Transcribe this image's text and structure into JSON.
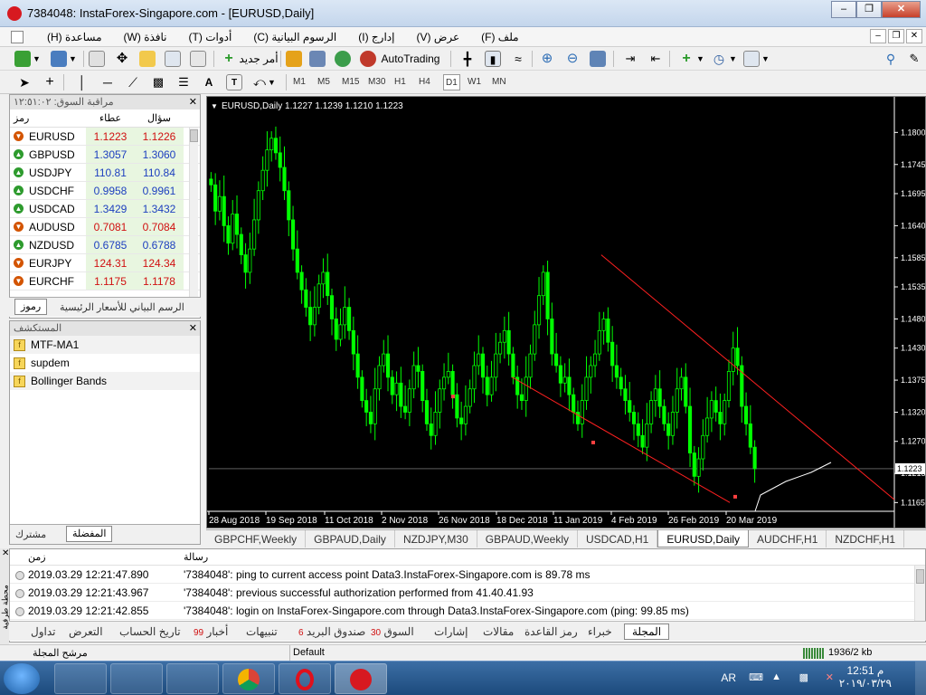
{
  "window": {
    "title": "7384048: InstaForex-Singapore.com - [EURUSD,Daily]"
  },
  "menu": [
    "ملف (F)",
    "عرض (V)",
    "إدارج (I)",
    "الرسوم البيانية (C)",
    "أدوات (T)",
    "نافذة (W)",
    "مساعدة (H)"
  ],
  "toolbar": {
    "new_order": "أمر جديد",
    "autotrading": "AutoTrading"
  },
  "timeframes": [
    "M1",
    "M5",
    "M15",
    "M30",
    "H1",
    "H4",
    "D1",
    "W1",
    "MN"
  ],
  "selected_timeframe": "D1",
  "market_watch": {
    "title": "مراقبة السوق: ١٢:٥١:٠٢",
    "columns": {
      "symbol": "رمز",
      "bid": "عطاء",
      "ask": "سؤال"
    },
    "rows": [
      {
        "symbol": "EURUSD",
        "bid": "1.1223",
        "ask": "1.1226",
        "dir": "down"
      },
      {
        "symbol": "GBPUSD",
        "bid": "1.3057",
        "ask": "1.3060",
        "dir": "up"
      },
      {
        "symbol": "USDJPY",
        "bid": "110.81",
        "ask": "110.84",
        "dir": "up"
      },
      {
        "symbol": "USDCHF",
        "bid": "0.9958",
        "ask": "0.9961",
        "dir": "up"
      },
      {
        "symbol": "USDCAD",
        "bid": "1.3429",
        "ask": "1.3432",
        "dir": "up"
      },
      {
        "symbol": "AUDUSD",
        "bid": "0.7081",
        "ask": "0.7084",
        "dir": "down"
      },
      {
        "symbol": "NZDUSD",
        "bid": "0.6785",
        "ask": "0.6788",
        "dir": "up"
      },
      {
        "symbol": "EURJPY",
        "bid": "124.31",
        "ask": "124.34",
        "dir": "down"
      },
      {
        "symbol": "EURCHF",
        "bid": "1.1175",
        "ask": "1.1178",
        "dir": "down"
      }
    ],
    "tabs": [
      "رموز",
      "الرسم البياني للأسعار الرئيسية"
    ]
  },
  "navigator": {
    "title": "المستكشف",
    "items": [
      "MTF-MA1",
      "supdem",
      "Bollinger Bands"
    ],
    "tabs": [
      "مشترك",
      "المفضلة"
    ]
  },
  "chart_data": {
    "type": "candlestick",
    "header": "EURUSD,Daily  1.1227 1.1239 1.1210 1.1223",
    "yticks": [
      "1.1800",
      "1.1745",
      "1.1695",
      "1.1640",
      "1.1585",
      "1.1535",
      "1.1480",
      "1.1430",
      "1.1375",
      "1.1320",
      "1.1270",
      "1.1215",
      "1.1165"
    ],
    "current_price": "1.1223",
    "xticks": [
      "28 Aug 2018",
      "19 Sep 2018",
      "11 Oct 2018",
      "2 Nov 2018",
      "26 Nov 2018",
      "18 Dec 2018",
      "11 Jan 2019",
      "4 Feb 2019",
      "26 Feb 2019",
      "20 Mar 2019"
    ],
    "ylim": [
      1.115,
      1.183
    ],
    "up_color": "#00ff00",
    "down_color": "#00ff00",
    "closes": [
      1.171,
      1.1665,
      1.169,
      1.164,
      1.161,
      1.166,
      1.1625,
      1.159,
      1.156,
      1.16,
      1.165,
      1.17,
      1.1735,
      1.177,
      1.179,
      1.1765,
      1.174,
      1.17,
      1.165,
      1.16,
      1.156,
      1.153,
      1.15,
      1.147,
      1.15,
      1.154,
      1.156,
      1.152,
      1.148,
      1.1445,
      1.147,
      1.15,
      1.146,
      1.142,
      1.138,
      1.134,
      1.132,
      1.13,
      1.136,
      1.14,
      1.142,
      1.138,
      1.135,
      1.137,
      1.133,
      1.132,
      1.136,
      1.14,
      1.139,
      1.134,
      1.13,
      1.128,
      1.132,
      1.136,
      1.138,
      1.139,
      1.135,
      1.131,
      1.13,
      1.133,
      1.136,
      1.14,
      1.142,
      1.138,
      1.135,
      1.138,
      1.142,
      1.144,
      1.146,
      1.142,
      1.138,
      1.135,
      1.134,
      1.138,
      1.142,
      1.147,
      1.152,
      1.156,
      1.148,
      1.142,
      1.14,
      1.137,
      1.138,
      1.135,
      1.132,
      1.13,
      1.134,
      1.138,
      1.14,
      1.142,
      1.146,
      1.148,
      1.144,
      1.14,
      1.138,
      1.136,
      1.134,
      1.132,
      1.13,
      1.128,
      1.126,
      1.13,
      1.134,
      1.136,
      1.133,
      1.13,
      1.128,
      1.132,
      1.136,
      1.138,
      1.133,
      1.125,
      1.121,
      1.124,
      1.128,
      1.131,
      1.134,
      1.132,
      1.13,
      1.134,
      1.139,
      1.143,
      1.14,
      1.133,
      1.13,
      1.126,
      1.1223
    ],
    "trendlines": [
      {
        "from": [
          0.48,
          1.159
        ],
        "to": [
          1.0,
          1.117
        ],
        "color": "#ff2020"
      },
      {
        "from": [
          0.35,
          1.138
        ],
        "to": [
          0.76,
          1.1165
        ],
        "color": "#ff2020"
      }
    ]
  },
  "chart_tabs": [
    "GBPCHF,Weekly",
    "GBPAUD,Daily",
    "NZDJPY,M30",
    "GBPAUD,Weekly",
    "USDCAD,H1",
    "EURUSD,Daily",
    "AUDCHF,H1",
    "NZDCHF,H1"
  ],
  "active_chart_tab": "EURUSD,Daily",
  "terminal": {
    "columns": {
      "time": "زمن",
      "message": "رسالة"
    },
    "rows": [
      {
        "time": "2019.03.29 12:21:47.890",
        "message": "'7384048': ping to current access point Data3.InstaForex-Singapore.com is 89.78 ms"
      },
      {
        "time": "2019.03.29 12:21:43.967",
        "message": "'7384048': previous successful authorization performed from 41.40.41.93"
      },
      {
        "time": "2019.03.29 12:21:42.855",
        "message": "'7384048': login on InstaForex-Singapore.com through Data3.InstaForex-Singapore.com (ping: 99.85 ms)"
      }
    ],
    "side_label": "محطة طرفية",
    "tabs": [
      {
        "label": "تداول",
        "badge": ""
      },
      {
        "label": "التعرض",
        "badge": ""
      },
      {
        "label": "تاريخ الحساب",
        "badge": ""
      },
      {
        "label": "أخبار",
        "badge": "99"
      },
      {
        "label": "تنبيهات",
        "badge": ""
      },
      {
        "label": "صندوق البريد",
        "badge": "6"
      },
      {
        "label": "السوق",
        "badge": "30"
      },
      {
        "label": "إشارات",
        "badge": ""
      },
      {
        "label": "مقالات",
        "badge": ""
      },
      {
        "label": "رمز القاعدة",
        "badge": ""
      },
      {
        "label": "خبراء",
        "badge": ""
      },
      {
        "label": "المجلة",
        "badge": ""
      }
    ],
    "active_tab": "المجلة"
  },
  "statusbar": {
    "left": "مرشح المجلة",
    "profile": "Default",
    "traffic": "1936/2 kb"
  },
  "taskbar": {
    "lang": "AR",
    "time": "12:51 م",
    "date": "٢٠١٩/٠٣/٢٩"
  }
}
